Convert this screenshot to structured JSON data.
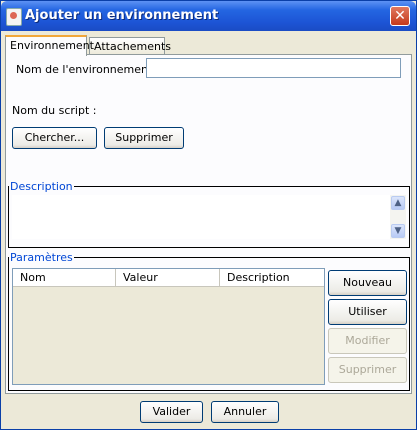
{
  "window": {
    "title": "Ajouter un environnement",
    "close_glyph": "✕"
  },
  "tabs": [
    {
      "label": "Environnement",
      "active": true
    },
    {
      "label": "Attachements",
      "active": false
    }
  ],
  "form": {
    "env_name_label": "Nom de l'environnement :",
    "env_name_value": "",
    "script_label": "Nom du script :",
    "browse_button": "Chercher...",
    "delete_button": "Supprimer"
  },
  "description": {
    "legend": "Description",
    "value": ""
  },
  "parameters": {
    "legend": "Paramètres",
    "columns": [
      "Nom",
      "Valeur",
      "Description"
    ],
    "buttons": {
      "new": "Nouveau",
      "use": "Utiliser",
      "edit": "Modifier",
      "delete": "Supprimer"
    }
  },
  "footer": {
    "ok": "Valider",
    "cancel": "Annuler"
  },
  "icons": {
    "scroll_up": "▲",
    "scroll_down": "▼"
  },
  "colors": {
    "titlebar": "#2466e2",
    "legend": "#0046d5",
    "active_tab_accent": "#f1a73a"
  }
}
